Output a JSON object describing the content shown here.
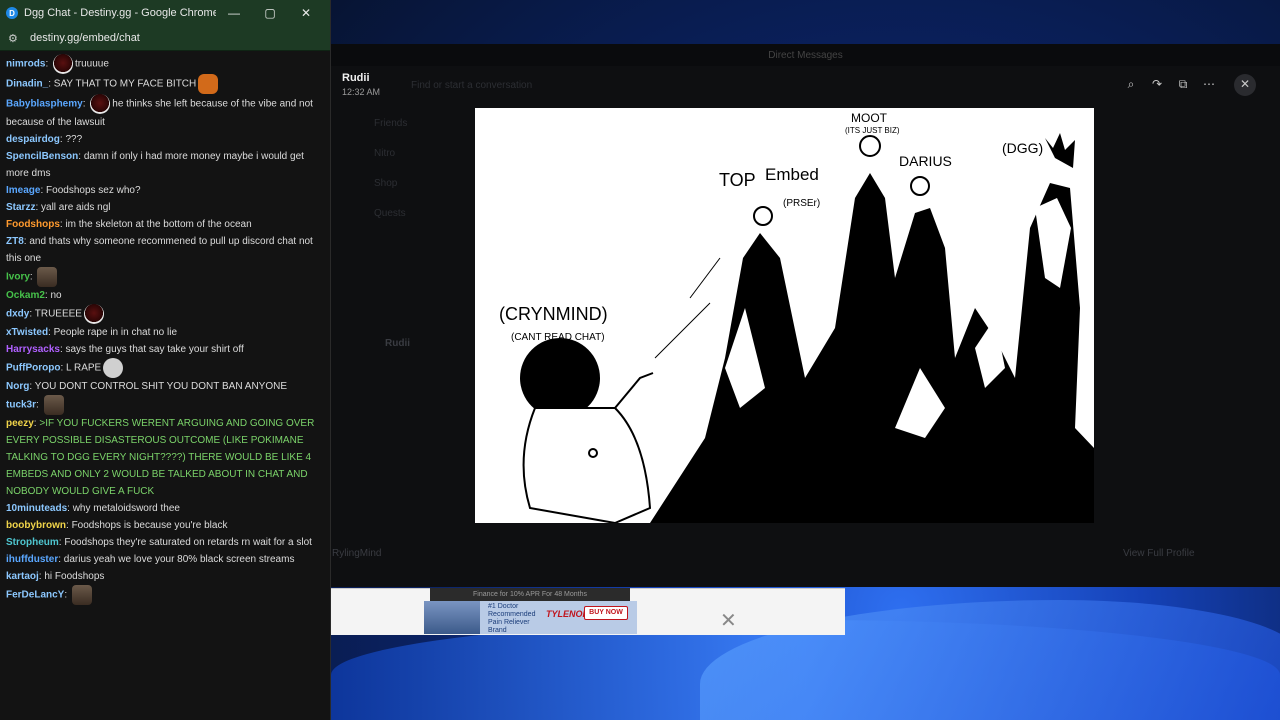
{
  "browser": {
    "title": "Dgg Chat - Destiny.gg - Google Chrome",
    "url": "destiny.gg/embed/chat",
    "controls": {
      "minimize": "—",
      "maximize": "▢",
      "close": "✕"
    }
  },
  "chat": [
    {
      "user": "nimrods",
      "color": "light",
      "text": "truuuue",
      "emote_before": true
    },
    {
      "user": "Dinadin_",
      "color": "light",
      "text": "SAY THAT TO MY FACE BITCH",
      "emote_after": "pepe"
    },
    {
      "user": "Babyblasphemy",
      "color": "blue",
      "text": "he thinks she left because of the vibe and not because of the lawsuit",
      "emote_before": true
    },
    {
      "user": "despairdog",
      "color": "light",
      "text": "???"
    },
    {
      "user": "SpencilBenson",
      "color": "light",
      "text": "damn if only i had more money maybe i would get more dms"
    },
    {
      "user": "Imeage",
      "color": "blue",
      "text": "Foodshops sez who?"
    },
    {
      "user": "Starzz",
      "color": "light",
      "text": "yall are aids ngl"
    },
    {
      "user": "Foodshops",
      "color": "orange",
      "text": "im the skeleton at the bottom of the ocean"
    },
    {
      "user": "ZT8",
      "color": "light",
      "text": "and thats why someone recommened to pull up discord chat not this one"
    },
    {
      "user": "Ivory",
      "color": "green",
      "text": "",
      "emote_after": "photo"
    },
    {
      "user": "Ockam2",
      "color": "green",
      "text": "no"
    },
    {
      "user": "dxdy",
      "color": "light",
      "text": "TRUEEEE",
      "emote_after": "ring"
    },
    {
      "user": "xTwisted",
      "color": "light",
      "text": "People rape in in chat no lie"
    },
    {
      "user": "Harrysacks",
      "color": "purple",
      "text": "says the guys that say take your shirt off"
    },
    {
      "user": "PuffPoropo",
      "color": "light",
      "text": "L RAPE",
      "emote_after": "face"
    },
    {
      "user": "Norg",
      "color": "light",
      "text": "YOU DONT CONTROL SHIT YOU DONT BAN ANYONE"
    },
    {
      "user": "tuck3r",
      "color": "light",
      "text": "",
      "emote_after": "photo"
    },
    {
      "user": "peezy",
      "color": "yellow",
      "text": ">IF YOU FUCKERS WERENT ARGUING AND GOING OVER EVERY POSSIBLE DISASTEROUS OUTCOME (LIKE POKIMANE TALKING TO DGG EVERY NIGHT????) THERE WOULD BE LIKE 4 EMBEDS AND ONLY 2 WOULD BE TALKED ABOUT IN CHAT AND NOBODY WOULD GIVE A FUCK",
      "greentext": true
    },
    {
      "user": "10minuteads",
      "color": "light",
      "text": "why metaloidsword thee"
    },
    {
      "user": "boobybrown",
      "color": "yellow",
      "text": "Foodshops  is because you're black"
    },
    {
      "user": "Stropheum",
      "color": "teal",
      "text": "Foodshops they're saturated on retards rn wait for a slot"
    },
    {
      "user": "ihuffduster",
      "color": "blue",
      "text": "darius yeah we love your 80% black screen streams"
    },
    {
      "user": "kartaoj",
      "color": "light",
      "text": "hi Foodshops"
    },
    {
      "user": "FerDeLancY",
      "color": "light",
      "text": "",
      "emote_after": "photo"
    }
  ],
  "discord": {
    "window_title": "Direct Messages",
    "sender": "Rudii",
    "time": "12:32 AM",
    "footer_name": "RylingMind",
    "view_profile": "View Full Profile",
    "toolbar": [
      "zoom-icon",
      "forward-icon",
      "open-icon",
      "more-icon",
      "close-icon"
    ]
  },
  "drawing": {
    "labels": [
      "MOOT",
      "(ITS JUST BIZ)",
      "TOP",
      "Embed",
      "(PRSEr)",
      "DARIUS",
      "(DGG)",
      "(CRYNMIND)",
      "(CANT READ CHAT)"
    ]
  },
  "ad": {
    "banner": "Finance for 10% APR For 48 Months",
    "line1": "#1 Doctor",
    "line2": "Recommended",
    "line3": "Pain Reliever",
    "line4": "Brand",
    "brand": "TYLENOL",
    "cta": "BUY NOW"
  }
}
